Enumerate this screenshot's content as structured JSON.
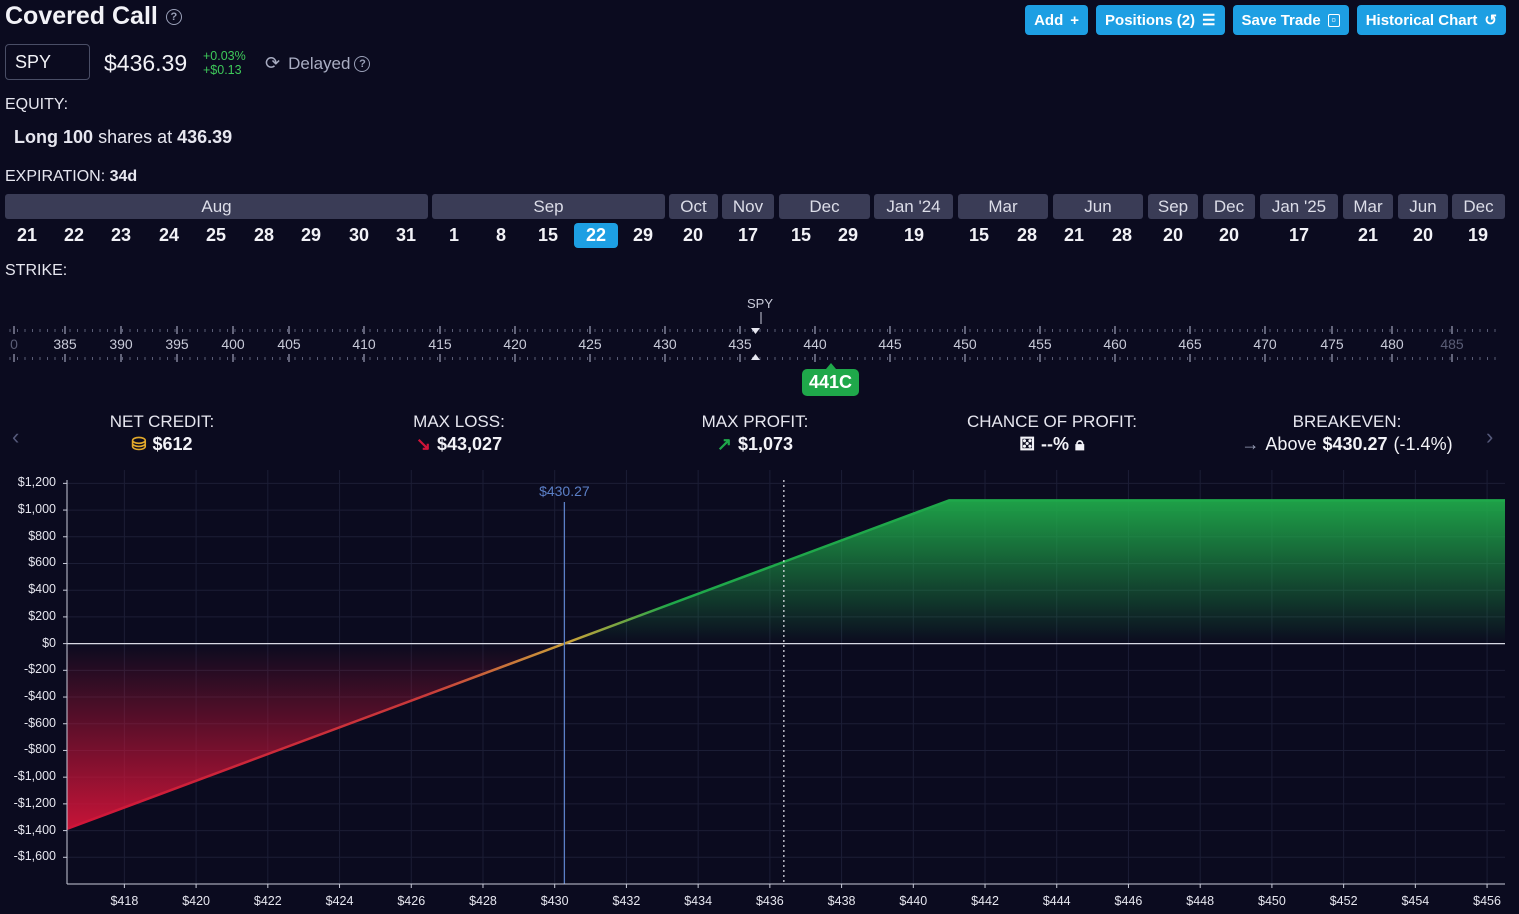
{
  "title": "Covered Call",
  "toolbar": {
    "add": "Add",
    "positions": "Positions (2)",
    "save": "Save Trade",
    "historical": "Historical Chart"
  },
  "ticker": {
    "symbol": "SPY",
    "price": "$436.39",
    "change_pct": "+0.03%",
    "change_abs": "+$0.13",
    "status": "Delayed"
  },
  "equity": {
    "label": "EQUITY:",
    "side": "Long",
    "qty": "100",
    "mid": "shares at",
    "price": "436.39"
  },
  "expiration": {
    "label": "EXPIRATION:",
    "value": "34d",
    "months": [
      "Aug",
      "Sep",
      "Oct",
      "Nov",
      "Dec",
      "Jan '24",
      "Mar",
      "Jun",
      "Sep",
      "Dec",
      "Jan '25",
      "Mar",
      "Jun",
      "Dec"
    ],
    "days": [
      "21",
      "22",
      "23",
      "24",
      "25",
      "28",
      "29",
      "30",
      "31",
      "1",
      "8",
      "15",
      "22",
      "29",
      "20",
      "17",
      "15",
      "29",
      "19",
      "15",
      "28",
      "21",
      "28",
      "20",
      "20",
      "17",
      "21",
      "20",
      "19"
    ],
    "selected_day_index": 12
  },
  "strike": {
    "label": "STRIKE:",
    "ticks": [
      "0",
      "385",
      "390",
      "395",
      "400",
      "405",
      "410",
      "415",
      "420",
      "425",
      "430",
      "435",
      "440",
      "445",
      "450",
      "455",
      "460",
      "465",
      "470",
      "475",
      "480",
      "485"
    ],
    "spy_marker": "SPY",
    "selected": "441C"
  },
  "stats": {
    "net_credit": {
      "label": "NET CREDIT:",
      "value": "$612"
    },
    "max_loss": {
      "label": "MAX LOSS:",
      "value": "$43,027"
    },
    "max_profit": {
      "label": "MAX PROFIT:",
      "value": "$1,073"
    },
    "chance": {
      "label": "CHANCE OF PROFIT:",
      "value": "--%"
    },
    "breakeven": {
      "label": "BREAKEVEN:",
      "prefix": "Above",
      "value": "$430.27",
      "suffix": "(-1.4%)"
    }
  },
  "chart_data": {
    "type": "line",
    "breakeven_label": "$430.27",
    "y_ticks": [
      "$1,200",
      "$1,000",
      "$800",
      "$600",
      "$400",
      "$200",
      "$0",
      "-$200",
      "-$400",
      "-$600",
      "-$800",
      "-$1,000",
      "-$1,200",
      "-$1,400",
      "-$1,600"
    ],
    "x_ticks": [
      "$418",
      "$420",
      "$422",
      "$424",
      "$426",
      "$428",
      "$430",
      "$432",
      "$434",
      "$436",
      "$438",
      "$440",
      "$442",
      "$444",
      "$446",
      "$448",
      "$450",
      "$452",
      "$454",
      "$456"
    ],
    "x": [
      416.4,
      430.27,
      436.39,
      441,
      456.5
    ],
    "y": [
      -1387,
      0,
      612,
      1073,
      1073
    ],
    "xlim": [
      416.4,
      456.5
    ],
    "ylim": [
      -1800,
      1300
    ],
    "breakeven_x": 430.27,
    "current_price_x": 436.39,
    "colors": {
      "profit": "#1fa84a",
      "loss": "#d01439",
      "accent": "#1d9fe3"
    }
  }
}
